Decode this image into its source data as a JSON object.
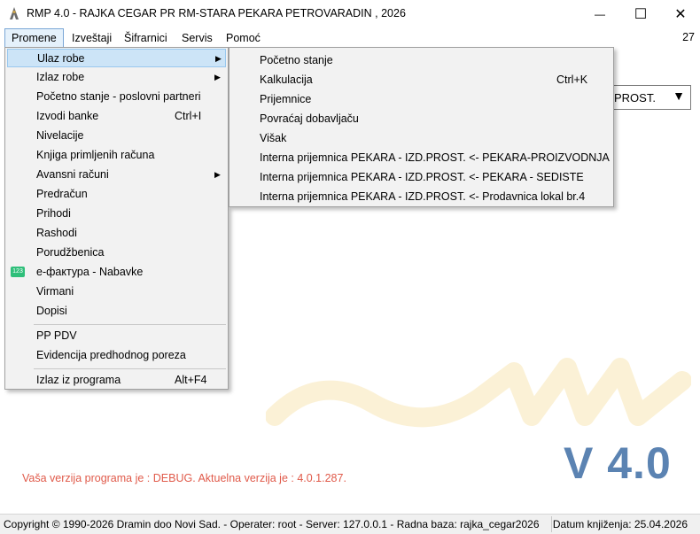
{
  "window": {
    "title": "RMP 4.0 - RAJKA CEGAR PR RM-STARA PEKARA PETROVARADIN , 2026",
    "minimize_glyph": "—",
    "maximize_glyph": "☐",
    "close_glyph": "✕"
  },
  "menubar": {
    "items": [
      {
        "label": "Promene"
      },
      {
        "label": "Izveštaji"
      },
      {
        "label": "Šifrarnici"
      },
      {
        "label": "Servis"
      },
      {
        "label": "Pomoć"
      }
    ],
    "right_number": "27"
  },
  "combo": {
    "value": "PROST.",
    "arrow": "▼"
  },
  "dropdown": {
    "items": [
      {
        "label": "Ulaz robe",
        "arrow": "▶"
      },
      {
        "label": "Izlaz robe",
        "arrow": "▶"
      },
      {
        "label": "Početno stanje - poslovni partneri"
      },
      {
        "label": "Izvodi banke",
        "shortcut": "Ctrl+I"
      },
      {
        "label": "Nivelacije"
      },
      {
        "label": "Knjiga primljenih računa"
      },
      {
        "label": "Avansni računi",
        "arrow": "▶"
      },
      {
        "label": "Predračun"
      },
      {
        "label": "Prihodi"
      },
      {
        "label": "Rashodi"
      },
      {
        "label": "Porudžbenica"
      },
      {
        "label": "е-фактура - Nabavke",
        "icon_text": "123"
      },
      {
        "label": "Virmani"
      },
      {
        "label": "Dopisi"
      },
      {
        "label": "PP PDV"
      },
      {
        "label": "Evidencija predhodnog poreza"
      },
      {
        "label": "Izlaz iz programa",
        "shortcut": "Alt+F4"
      }
    ]
  },
  "submenu": {
    "items": [
      {
        "label": "Početno stanje"
      },
      {
        "label": "Kalkulacija",
        "shortcut": "Ctrl+K"
      },
      {
        "label": "Prijemnice"
      },
      {
        "label": "Povraćaj dobavljaču"
      },
      {
        "label": "Višak"
      },
      {
        "label": "Interna prijemnica  PEKARA - IZD.PROST. <- PEKARA-PROIZVODNJA"
      },
      {
        "label": "Interna prijemnica  PEKARA - IZD.PROST. <- PEKARA - SEDISTE"
      },
      {
        "label": "Interna prijemnica  PEKARA - IZD.PROST. <- Prodavnica lokal br.4"
      }
    ]
  },
  "main": {
    "version_big": "V 4.0",
    "debug_text": "Vaša verzija programa je : DEBUG. Aktuelna verzija je : 4.0.1.287."
  },
  "statusbar": {
    "left": "Copyright © 1990-2026 Dramin doo Novi Sad. - Operater: root - Server: 127.0.0.1 - Radna baza: rajka_cegar2026",
    "right": "Datum knjiženja: 25.04.2026"
  },
  "colors": {
    "accent_highlight": "#cce4f7",
    "version_blue": "#5b83b2",
    "debug_red": "#e05a4a",
    "watermark_yellow": "#fbf1d6"
  }
}
